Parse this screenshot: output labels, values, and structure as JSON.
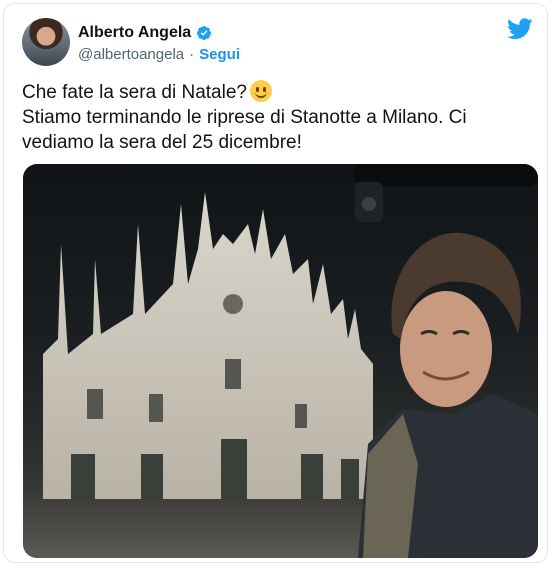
{
  "author": {
    "name": "Alberto Angela",
    "handle": "@albertoangela",
    "separator": "·",
    "follow_label": "Segui"
  },
  "icons": {
    "verified": "verified-badge-icon",
    "platform": "twitter-bird-icon",
    "emoji": "slightly-smiling-face-emoji"
  },
  "tweet": {
    "line1": "Che fate la sera di Natale?",
    "line2": "Stiamo terminando le riprese di Stanotte a Milano. Ci vediamo la sera del 25 dicembre!"
  },
  "colors": {
    "accent": "#1b95e0",
    "twitter_blue": "#1da1f2",
    "text": "#0f1419",
    "secondary_text": "#536471"
  }
}
